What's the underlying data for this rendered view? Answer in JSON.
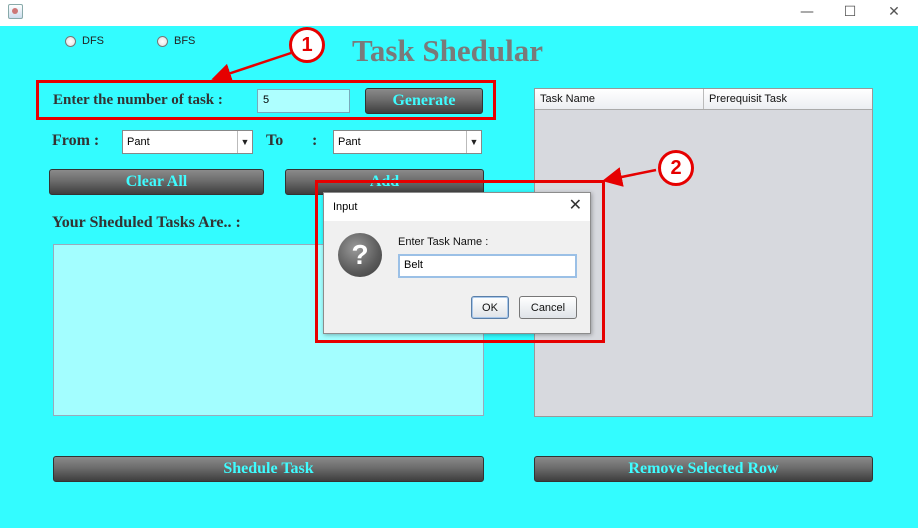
{
  "window": {
    "title": "",
    "controls": {
      "minimize": "—",
      "maximize": "☐",
      "close": "✕"
    }
  },
  "radios": [
    {
      "label": "DFS"
    },
    {
      "label": "BFS"
    }
  ],
  "app_title": "Task Shedular",
  "task_count": {
    "label": "Enter the number of task :",
    "value": "5",
    "button": "Generate"
  },
  "from": {
    "label": "From :",
    "value": "Pant"
  },
  "to": {
    "label": "To",
    "colon": ":",
    "value": "Pant"
  },
  "buttons": {
    "clear_all": "Clear All",
    "add": "Add",
    "shedule_task": "Shedule Task",
    "remove_row": "Remove Selected Row"
  },
  "scheduled_label": "Your Sheduled Tasks Are.. :",
  "table": {
    "columns": [
      "Task Name",
      "Prerequisit Task"
    ]
  },
  "annotations": {
    "badge1": "1",
    "badge2": "2",
    "color": "#e60000"
  },
  "dialog": {
    "title": "Input",
    "prompt": "Enter Task Name :",
    "input_value": "Belt",
    "ok": "OK",
    "cancel": "Cancel",
    "icon": "question-icon"
  },
  "colors": {
    "background": "#33fcff",
    "button_text": "#3ffcff",
    "accent_red": "#e60000"
  }
}
